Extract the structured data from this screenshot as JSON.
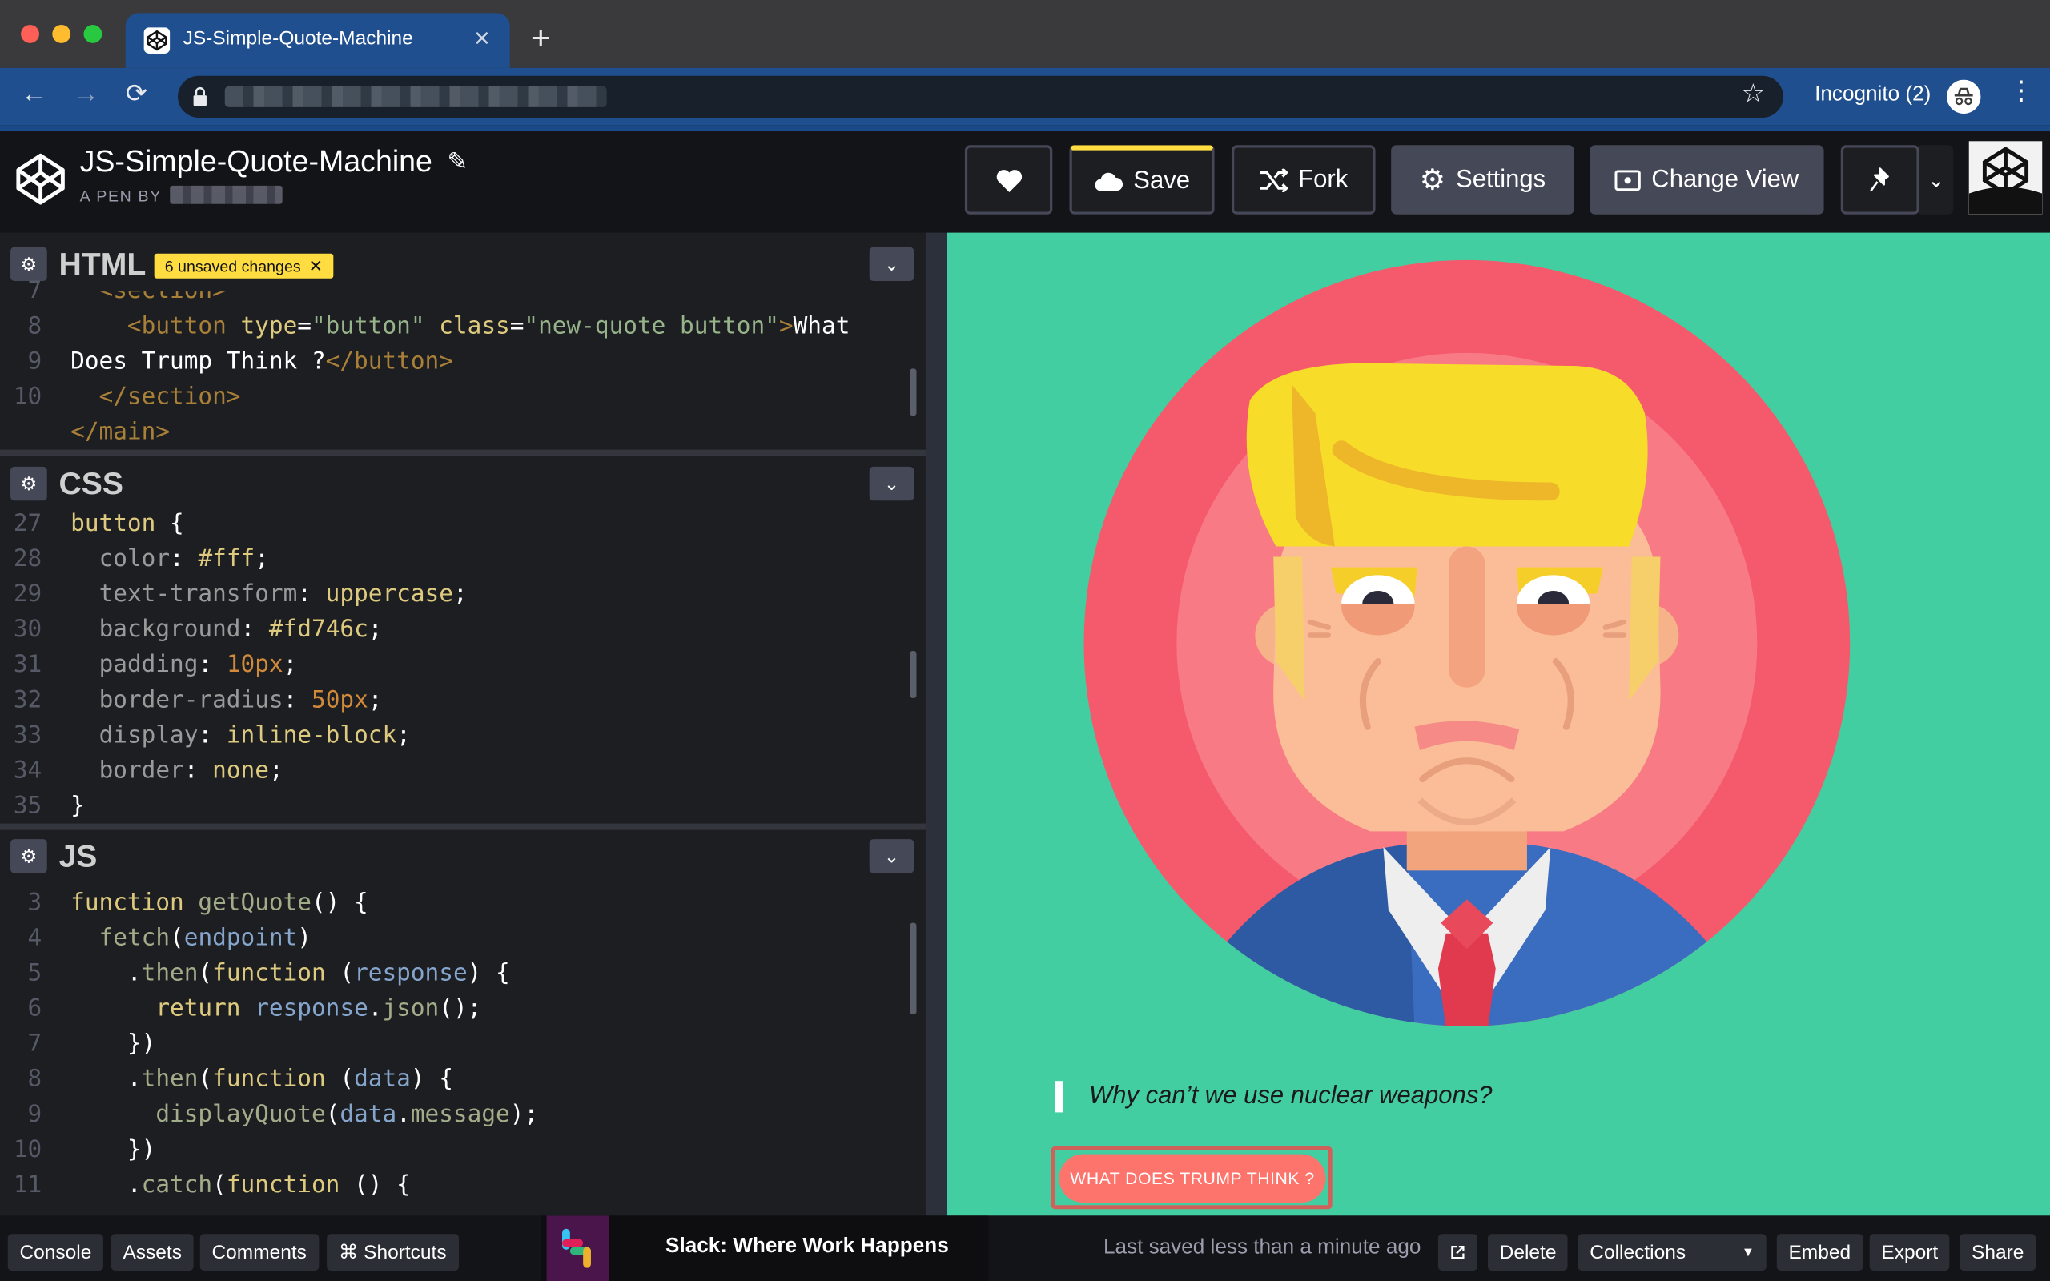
{
  "browser": {
    "tab_title": "JS-Simple-Quote-Machine",
    "tab_close": "✕",
    "new_tab": "+",
    "incognito_label": "Incognito (2)"
  },
  "codepen": {
    "pen_title": "JS-Simple-Quote-Machine",
    "pen_by": "A PEN BY",
    "buttons": {
      "save": "Save",
      "fork": "Fork",
      "settings": "Settings",
      "change_view": "Change View"
    }
  },
  "editors": {
    "html": {
      "name": "HTML",
      "unsaved_badge": "6 unsaved changes",
      "gutter": [
        "7",
        "8",
        "",
        "9",
        "10"
      ]
    },
    "css": {
      "name": "CSS",
      "gutter": [
        "27",
        "28",
        "29",
        "30",
        "31",
        "32",
        "33",
        "34",
        "35"
      ]
    },
    "js": {
      "name": "JS",
      "gutter": [
        "3",
        "4",
        "5",
        "6",
        "7",
        "8",
        "9",
        "10",
        "11"
      ]
    }
  },
  "result": {
    "quote": "Why can’t we use nuclear weapons?",
    "button_label": "WHAT DOES TRUMP THINK ?"
  },
  "bottom_bar": {
    "console": "Console",
    "assets": "Assets",
    "comments": "Comments",
    "shortcuts": "⌘ Shortcuts",
    "slack_ad": "Slack: Where Work Happens",
    "last_saved": "Last saved less than a minute ago",
    "delete": "Delete",
    "collections": "Collections",
    "embed": "Embed",
    "export": "Export",
    "share": "Share"
  },
  "colors": {
    "result_bg": "#43cea2",
    "quote_button": "#fd746c",
    "save_accent": "#ffdd40",
    "browser_blue": "#1f4f8f"
  }
}
